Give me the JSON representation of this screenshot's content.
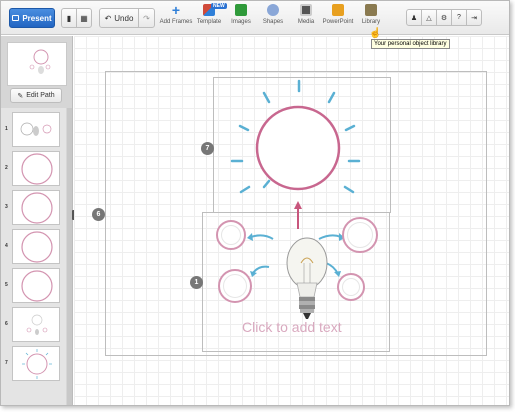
{
  "toolbar": {
    "present_label": "Present",
    "undo_label": "Undo",
    "new_badge": "NEW",
    "tools": [
      {
        "label": "Add Frames",
        "icon": "plus-icon",
        "color": "#2f7fd8"
      },
      {
        "label": "Template",
        "icon": "template-icon",
        "color": "#d04a3a"
      },
      {
        "label": "Images",
        "icon": "images-icon",
        "color": "#2f9a3a"
      },
      {
        "label": "Shapes",
        "icon": "shapes-icon",
        "color": "#8aa7d8"
      },
      {
        "label": "Media",
        "icon": "film-icon",
        "color": "#555555"
      },
      {
        "label": "PowerPoint",
        "icon": "powerpoint-icon",
        "color": "#e8a020"
      },
      {
        "label": "Library",
        "icon": "library-icon",
        "color": "#8a7a50"
      }
    ]
  },
  "tooltip": "Your personal object library",
  "sidebar": {
    "edit_path_label": "Edit Path",
    "path_items": [
      "1",
      "2",
      "3",
      "4",
      "5",
      "6",
      "7"
    ]
  },
  "canvas": {
    "badges": [
      "6",
      "7",
      "1"
    ],
    "click_to_add_text": "Click to add text"
  },
  "colors": {
    "accent": "#2265c2",
    "circle": "#d394b0",
    "arrow": "#5ab0d3",
    "pink_arrow": "#c8567d"
  }
}
